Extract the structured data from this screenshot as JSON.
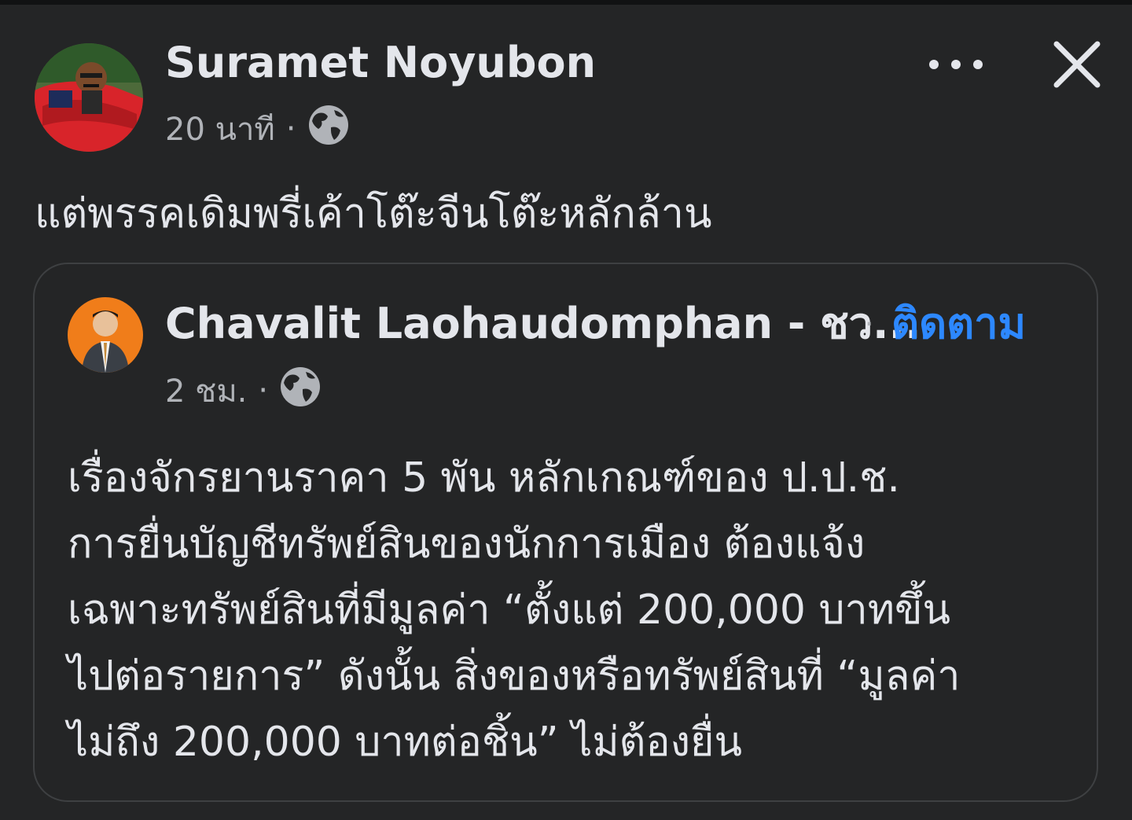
{
  "post": {
    "author": "Suramet Noyubon",
    "time": "20 นาที",
    "separator": "·",
    "visibility_icon": "globe-icon",
    "text": "แต่พรรคเดิมพรี่เค้าโต๊ะจีนโต๊ะหลักล้าน",
    "more_icon": "more-options-icon",
    "close_icon": "close-icon"
  },
  "shared": {
    "author": "Chavalit Laohaudomphan - ชว...",
    "separator": "·",
    "follow_label": "ติดตาม",
    "time": "2 ชม.",
    "visibility_icon": "globe-icon",
    "lines": [
      "เรื่องจักรยานราคา 5 พัน หลักเกณฑ์ของ ป.ป.ช.",
      "การยื่นบัญชีทรัพย์สินของนักการเมือง ต้องแจ้ง",
      "เฉพาะทรัพย์สินที่มีมูลค่า “ตั้งแต่ 200,000 บาทขึ้น",
      "ไปต่อรายการ” ดังนั้น สิ่งของหรือทรัพย์สินที่ “มูลค่า",
      "ไม่ถึง 200,000 บาทต่อชิ้น” ไม่ต้องยื่น"
    ]
  },
  "colors": {
    "background": "#242526",
    "primary_text": "#e4e6eb",
    "secondary_text": "#b0b3b8",
    "link": "#2d88ff",
    "card_border": "#3e4042"
  }
}
